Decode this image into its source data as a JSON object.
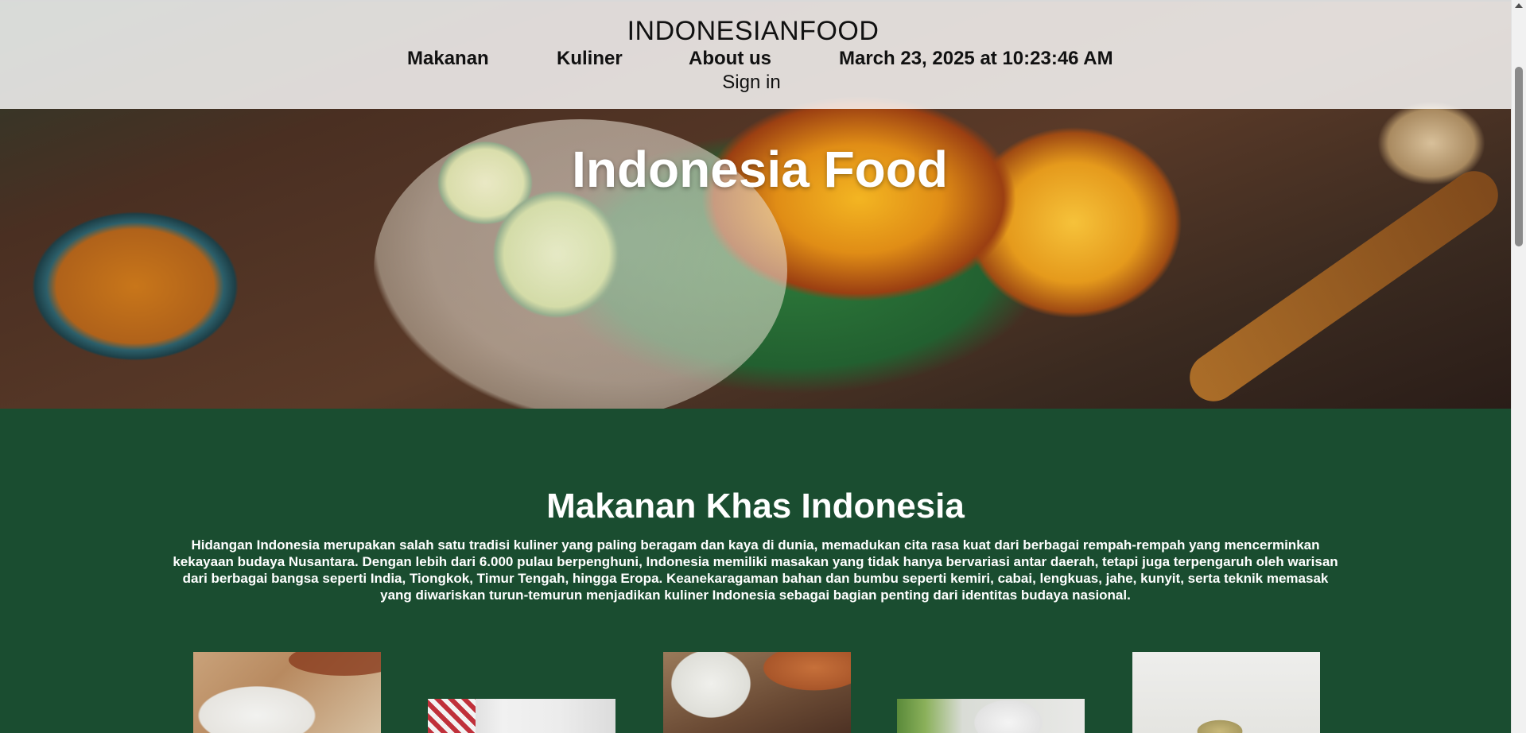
{
  "header": {
    "brand": "INDONESIANFOOD",
    "nav": [
      {
        "label": "Makanan"
      },
      {
        "label": "Kuliner"
      },
      {
        "label": "About us"
      }
    ],
    "datetime": "March 23, 2025 at 10:23:46 AM",
    "signin_label": "Sign in"
  },
  "hero": {
    "title": "Indonesia Food"
  },
  "main": {
    "section_title": "Makanan Khas Indonesia",
    "section_text": "Hidangan Indonesia merupakan salah satu tradisi kuliner yang paling beragam dan kaya di dunia, memadukan cita rasa kuat dari berbagai rempah-rempah yang mencerminkan kekayaan budaya Nusantara. Dengan lebih dari 6.000 pulau berpenghuni, Indonesia memiliki masakan yang tidak hanya bervariasi antar daerah, tetapi juga terpengaruh oleh warisan dari berbagai bangsa seperti India, Tiongkok, Timur Tengah, hingga Eropa. Keanekaragaman bahan dan bumbu seperti kemiri, cabai, lengkuas, jahe, kunyit, serta teknik memasak yang diwariskan turun-temurun menjadikan kuliner Indonesia sebagai bagian penting dari identitas budaya nasional."
  },
  "colors": {
    "content_bg": "#1a4d30",
    "header_bg": "#ffffff",
    "text_light": "#ffffff",
    "text_dark": "#111111"
  }
}
